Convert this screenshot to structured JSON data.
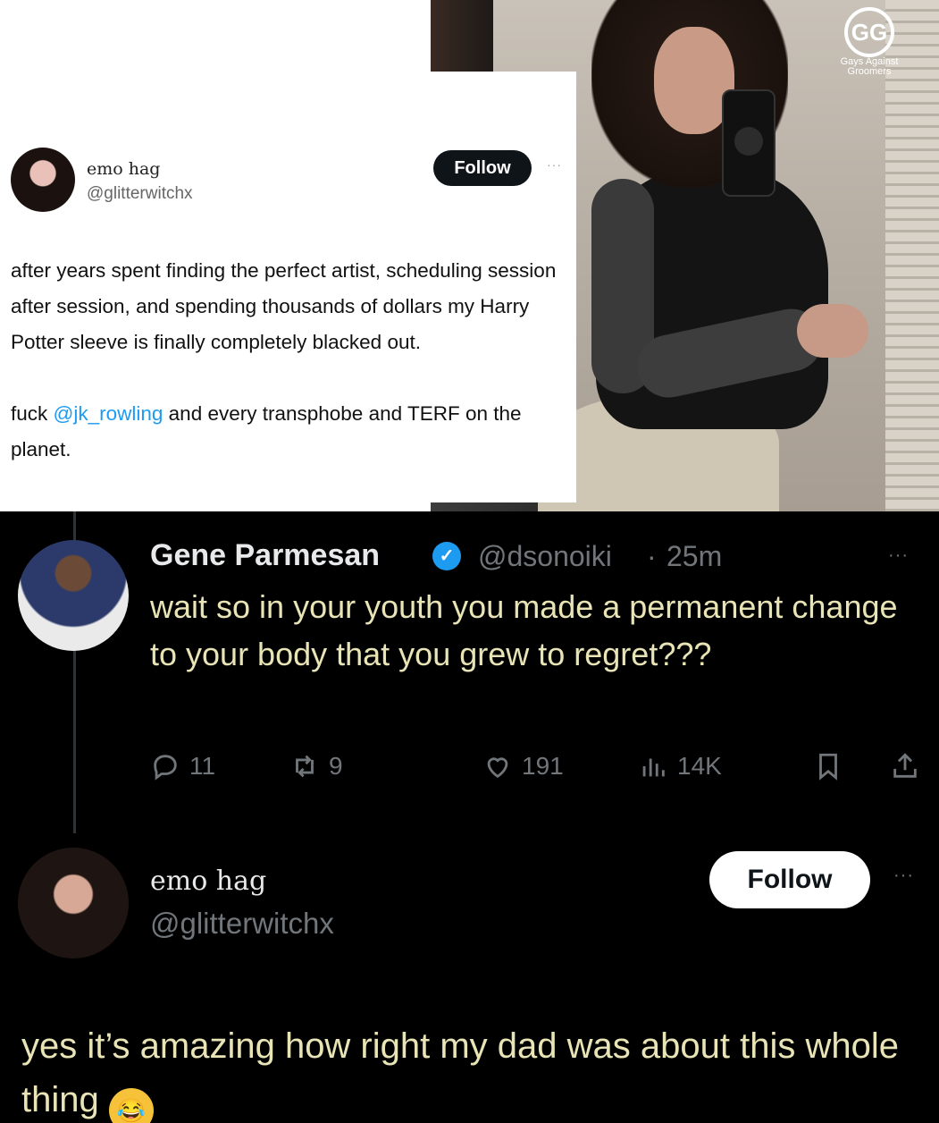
{
  "original_tweet": {
    "display_name": "emo hag",
    "handle": "@glitterwitchx",
    "follow_label": "Follow",
    "more_label": "···",
    "text_part1": "after years spent finding the perfect artist, scheduling session after session, and spending thousands of dollars my Harry Potter sleeve is finally completely blacked out.",
    "text_part2_prefix": "fuck ",
    "text_part2_mention": "@jk_rowling",
    "text_part2_suffix": " and every transphobe and TERF on the planet."
  },
  "watermark": {
    "logo_glyph": "GG",
    "line1": "Gays Against",
    "line2": "Groomers"
  },
  "reply": {
    "display_name": "Gene Parmesan",
    "verified_glyph": "✓",
    "handle": "@dsonoiki",
    "separator": "·",
    "time": "25m",
    "more_label": "···",
    "text": "wait so in your youth you made a permanent change to your body that you grew to regret???",
    "actions": {
      "replies": "11",
      "retweets": "9",
      "likes": "191",
      "views": "14K"
    }
  },
  "response": {
    "display_name": "emo hag",
    "handle": "@glitterwitchx",
    "follow_label": "Follow",
    "more_label": "···",
    "text": "yes it’s amazing how right my dad was about this whole thing",
    "emoji_glyph": "😂"
  },
  "colors": {
    "dark_bg": "#000000",
    "reply_text": "#e8e4b5",
    "muted": "#71767b",
    "accent": "#1d9bf0"
  }
}
